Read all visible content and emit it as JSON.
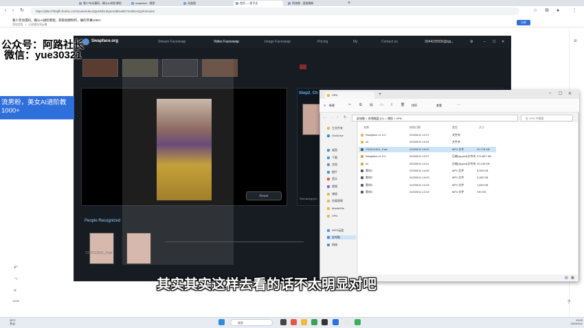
{
  "browser": {
    "tabs": [
      {
        "label": "看少年动漫码，确认AI进阶课程"
      },
      {
        "label": "swapface - 搜索"
      },
      {
        "label": "动画图"
      },
      {
        "label": "首页 — 程子达"
      },
      {
        "label": "同旅图 - 速度最新"
      }
    ],
    "url": "https://j95o7f40jdh.feishu.cn/minutes/obcnQp3Wb1dQemd9DwbE7mn8KmQy#minutes",
    "bookmark_title": "看少年动漫码，确认AI进阶教程，获取视频制作，确的字幕1000+",
    "bookmark_sub": "添加页签　|　已经保存到云端",
    "share_label": "分享"
  },
  "app": {
    "logo_text": "Swapface.org",
    "nav": [
      "Stream Faceswap",
      "Video Faceswap",
      "Image Faceswap",
      "Pricing",
      "My",
      "Contact us"
    ],
    "account": "3044235556@qq...",
    "step2_label": "Step2. Ch",
    "reset_label": "Reset",
    "remaining_label": "Remaining tim",
    "people_label": "People Recognized",
    "video_name": "2305111501_Fast"
  },
  "watermark": {
    "line1": "公众号：阿路社长",
    "line2": "微信：yue30321",
    "banner": "流男粉，美女AI进阶教\n1000+"
  },
  "explorer": {
    "tab_label": "VPN",
    "new_label": "新建",
    "sort_label": "排序",
    "view_label": "查看",
    "breadcrumb": "此电脑  >  本地磁盘 (D:)  >  课程  >  VPN",
    "search_placeholder": "在 VPN 中搜索",
    "columns": [
      "名称",
      "修改日期",
      "类型",
      "大小"
    ],
    "nav_items": [
      "主文件夹",
      "OneDrive",
      "桌面",
      "下载",
      "文档",
      "图片",
      "音乐",
      "视频",
      "课程",
      "仿真视频",
      "MobileFile",
      "VPN",
      "WPS云盘",
      "此电脑",
      "网络"
    ],
    "files": [
      {
        "name": "Swapface v1.4.0",
        "date": "2023/5/11 12:27",
        "type": "文件夹",
        "size": ""
      },
      {
        "name": "s2",
        "date": "2023/5/11 14:21",
        "type": "文件夹",
        "size": ""
      },
      {
        "name": "2305111501_Fast",
        "date": "2023/5/11 15:32",
        "type": "MP4 文件",
        "size": "20,778 KB",
        "selected": true
      },
      {
        "name": "Swapface v1.4.0",
        "date": "2023/5/11 12:27",
        "type": "压缩(zipped)文件夹",
        "size": "374,897 KB"
      },
      {
        "name": "s2",
        "date": "2023/5/11 14:21",
        "type": "压缩(zipped)文件夹",
        "size": "20,139 KB"
      },
      {
        "name": "素材1",
        "date": "2023/5/11 14:40",
        "type": "MP4 文件",
        "size": "3,509 KB"
      },
      {
        "name": "素材2",
        "date": "2023/5/11 14:43",
        "type": "MP4 文件",
        "size": "3,282 KB"
      },
      {
        "name": "素材3",
        "date": "2023/5/11 14:43",
        "type": "MP4 文件",
        "size": "1,834 KB"
      },
      {
        "name": "素材4",
        "date": "2023/5/11 12:43",
        "type": "MP4 文件",
        "size": "740 KB"
      }
    ]
  },
  "subtitle": "其实其实这样去看的话不太明显对吧",
  "taskbar": {
    "search_label": "搜索",
    "weather_temp": "28°C",
    "weather_desc": "多云",
    "time": "13:03",
    "date": "2023/5/11"
  },
  "zoom_label": "100%",
  "colors": {
    "accent": "#2f6fdb",
    "app_bg": "#171c23",
    "selection": "#cce4f7"
  }
}
